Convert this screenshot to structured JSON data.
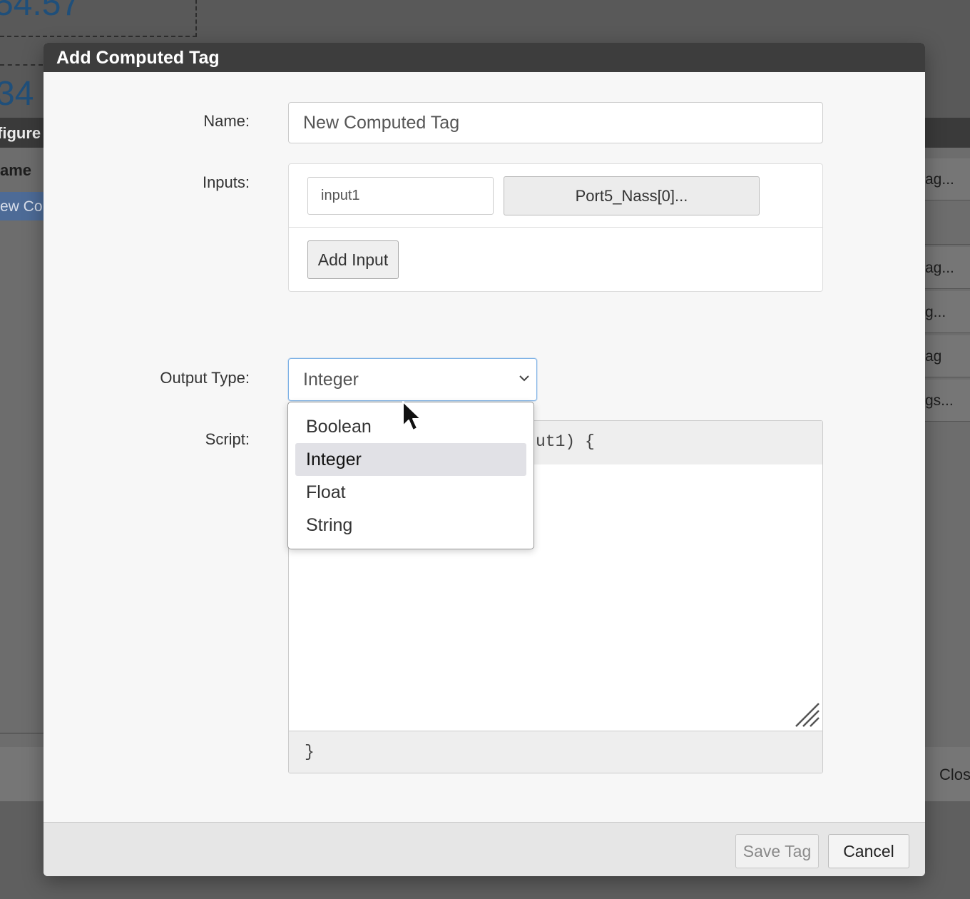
{
  "background": {
    "number_top": "54.57",
    "number_mid": "34",
    "window_title": "figure",
    "column_header": "ame",
    "selected_row": "ew Co",
    "right_items": [
      "ag...",
      "",
      "ag...",
      "g...",
      "ag",
      "gs..."
    ],
    "close_label": "Clos"
  },
  "dialog": {
    "title": "Add Computed Tag",
    "name_label": "Name:",
    "name_value": "New Computed Tag",
    "inputs_label": "Inputs:",
    "inputs": [
      {
        "name": "input1",
        "tag": "Port5_Nass[0]..."
      }
    ],
    "add_input_label": "Add Input",
    "output_type_label": "Output Type:",
    "output_type_value": "Integer",
    "script_label": "Script:",
    "script_header": "function compute(input1) {",
    "script_header_visible": "ut1) {",
    "script_footer": "}",
    "save_label": "Save Tag",
    "cancel_label": "Cancel"
  },
  "dropdown": {
    "options": [
      "Boolean",
      "Integer",
      "Float",
      "String"
    ],
    "selected": "Integer"
  },
  "colors": {
    "title_bar": "#3d3d3d",
    "dialog_bg": "#f7f7f7",
    "focus_border": "#7fb2e6",
    "option_highlight": "#e1e1e6",
    "selected_row_bg": "#4d6b97"
  }
}
